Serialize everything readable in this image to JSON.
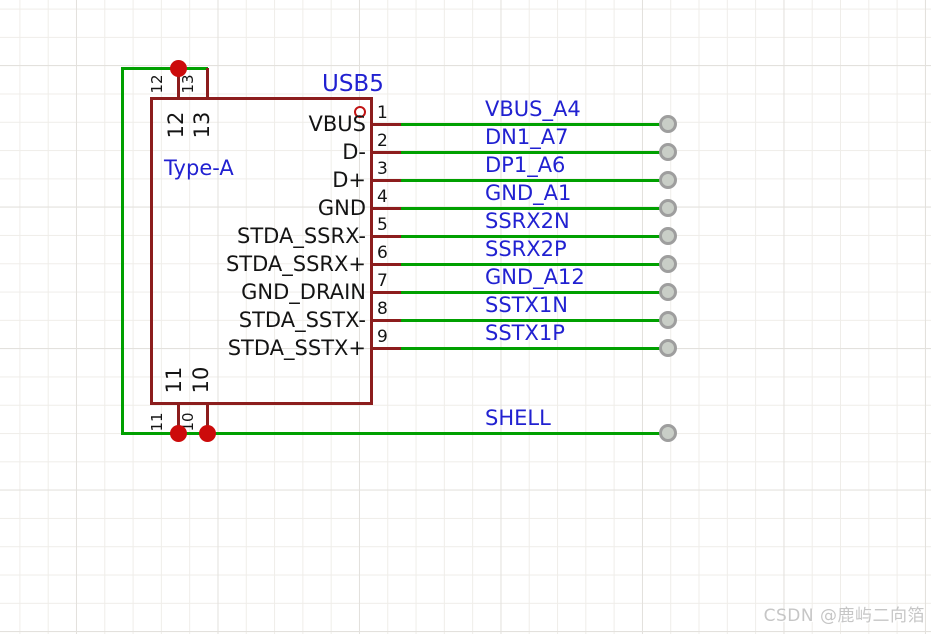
{
  "component": {
    "refdes": "USB5",
    "value": "Type-A",
    "right_pins": [
      {
        "number": "1",
        "name": "VBUS",
        "net": "VBUS_A4"
      },
      {
        "number": "2",
        "name": "D-",
        "net": "DN1_A7"
      },
      {
        "number": "3",
        "name": "D+",
        "net": "DP1_A6"
      },
      {
        "number": "4",
        "name": "GND",
        "net": "GND_A1"
      },
      {
        "number": "5",
        "name": "STDA_SSRX-",
        "net": "SSRX2N"
      },
      {
        "number": "6",
        "name": "STDA_SSRX+",
        "net": "SSRX2P"
      },
      {
        "number": "7",
        "name": "GND_DRAIN",
        "net": "GND_A12"
      },
      {
        "number": "8",
        "name": "STDA_SSTX-",
        "net": "SSTX1N"
      },
      {
        "number": "9",
        "name": "STDA_SSTX+",
        "net": "SSTX1P"
      }
    ],
    "top_pins": [
      {
        "number": "12",
        "name": "12"
      },
      {
        "number": "13",
        "name": "13"
      }
    ],
    "bottom_pins": [
      {
        "number": "11",
        "name": "11"
      },
      {
        "number": "10",
        "name": "10"
      }
    ],
    "shell_net": "SHELL"
  },
  "colors": {
    "symbol_outline": "#8c1d1d",
    "wire": "#00a000",
    "junction_dot": "#cc0b0b",
    "net_label_text": "#2121d1",
    "pin_text": "#141414",
    "terminal_ring": "#9e9e9e",
    "grid_minor": "#efede9",
    "grid_major": "#e3e1dd"
  },
  "watermark": "CSDN @鹿屿二向箔"
}
